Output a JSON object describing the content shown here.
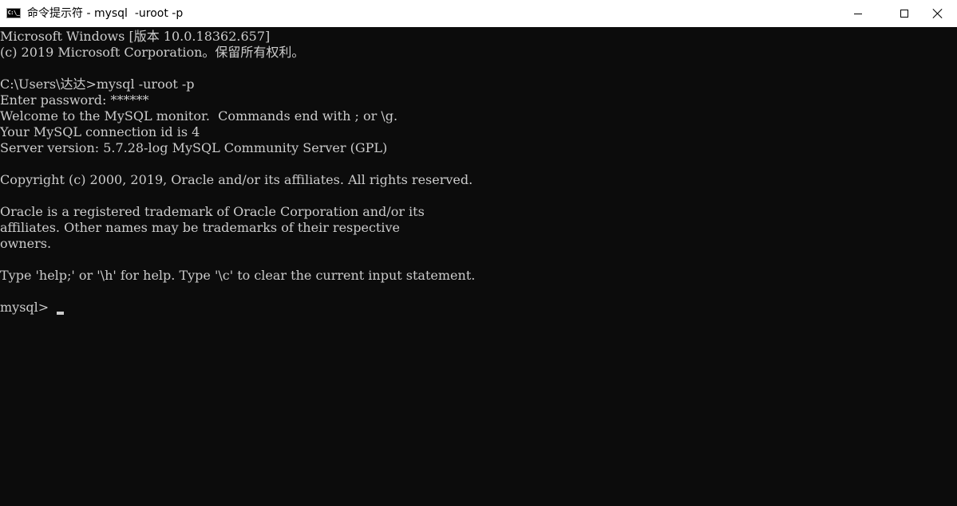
{
  "window": {
    "title": "命令提示符 - mysql  -uroot -p",
    "icon": "cmd-icon",
    "icon_text": "C:\\_",
    "controls": [
      "minimize-icon",
      "maximize-icon",
      "close-icon"
    ]
  },
  "console": {
    "background": "#0c0c0c",
    "foreground": "#cccccc",
    "lines": [
      "Microsoft Windows [版本 10.0.18362.657]",
      "(c) 2019 Microsoft Corporation。保留所有权利。",
      "",
      "C:\\Users\\达达>mysql -uroot -p",
      "Enter password: ******",
      "Welcome to the MySQL monitor.  Commands end with ; or \\g.",
      "Your MySQL connection id is 4",
      "Server version: 5.7.28-log MySQL Community Server (GPL)",
      "",
      "Copyright (c) 2000, 2019, Oracle and/or its affiliates. All rights reserved.",
      "",
      "Oracle is a registered trademark of Oracle Corporation and/or its",
      "affiliates. Other names may be trademarks of their respective",
      "owners.",
      "",
      "Type 'help;' or '\\h' for help. Type '\\c' to clear the current input statement.",
      ""
    ],
    "prompt": "mysql>"
  }
}
